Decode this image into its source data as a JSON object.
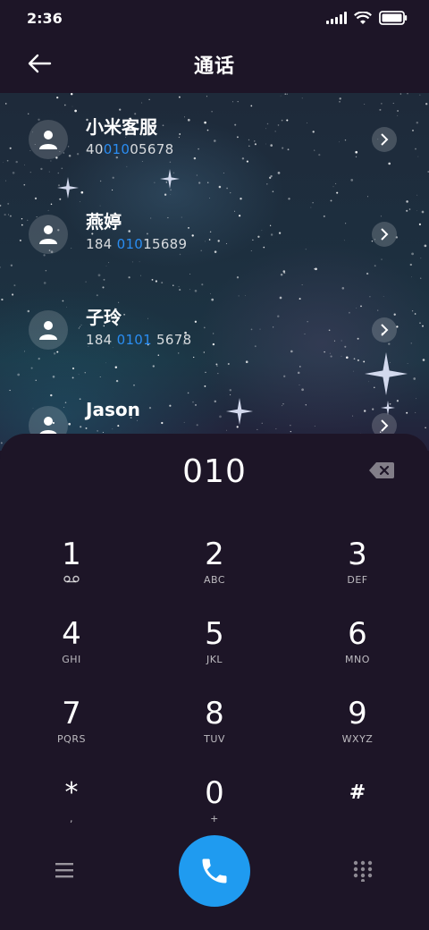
{
  "status": {
    "time": "2:36"
  },
  "header": {
    "title": "通话"
  },
  "contacts": [
    {
      "name": "小米客服",
      "num_pre": "40",
      "num_match": "010",
      "num_post": "05678"
    },
    {
      "name": "燕婷",
      "num_pre": "184 ",
      "num_match": "010",
      "num_post": "15689"
    },
    {
      "name": "子玲",
      "num_pre": "184 ",
      "num_match": "0101",
      "num_post": " 5678"
    },
    {
      "name": "Jason",
      "num_pre": "",
      "num_match": "",
      "num_post": ""
    }
  ],
  "dialer": {
    "entered": "010",
    "keys": [
      {
        "digit": "1",
        "letters": ""
      },
      {
        "digit": "2",
        "letters": "ABC"
      },
      {
        "digit": "3",
        "letters": "DEF"
      },
      {
        "digit": "4",
        "letters": "GHI"
      },
      {
        "digit": "5",
        "letters": "JKL"
      },
      {
        "digit": "6",
        "letters": "MNO"
      },
      {
        "digit": "7",
        "letters": "PQRS"
      },
      {
        "digit": "8",
        "letters": "TUV"
      },
      {
        "digit": "9",
        "letters": "WXYZ"
      },
      {
        "digit": "*",
        "letters": ","
      },
      {
        "digit": "0",
        "letters": "+"
      },
      {
        "digit": "#",
        "letters": ""
      }
    ]
  },
  "colors": {
    "accent": "#2a8df2",
    "call_button": "#1f9bf0",
    "background": "#1d1527"
  },
  "icons": {
    "back": "back-arrow-icon",
    "voicemail": "voicemail-icon",
    "delete": "backspace-icon",
    "menu": "menu-icon",
    "call": "phone-icon",
    "keypad": "keypad-grid-icon"
  }
}
